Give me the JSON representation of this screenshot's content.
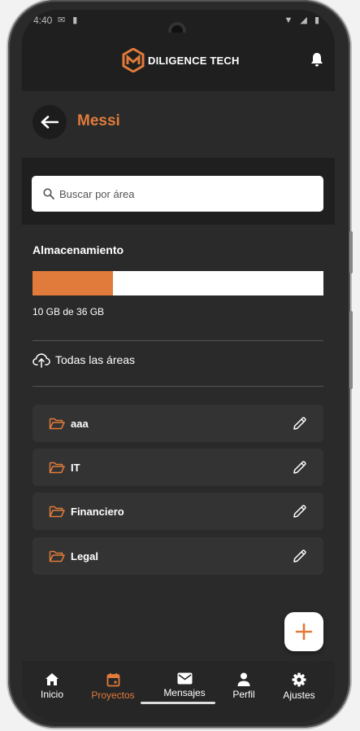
{
  "status_bar": {
    "time": "4:40",
    "left_icons": "✉ ▮",
    "right_icons": "▼ ◢ ▮"
  },
  "header": {
    "logo_text": "DILIGENCE TECH"
  },
  "title_bar": {
    "title": "Messi"
  },
  "search": {
    "placeholder": "Buscar por área",
    "value": ""
  },
  "storage": {
    "title": "Almacenamiento",
    "used_gb": 10,
    "total_gb": 36,
    "used_fraction": 0.2778,
    "label": "10 GB de 36 GB"
  },
  "all_areas": {
    "label": "Todas las áreas"
  },
  "areas": [
    {
      "name": "aaa"
    },
    {
      "name": "IT"
    },
    {
      "name": "Financiero"
    },
    {
      "name": "Legal"
    }
  ],
  "fab": {
    "label": "+"
  },
  "nav": [
    {
      "label": "Inicio",
      "icon": "home-icon",
      "active": false
    },
    {
      "label": "Proyectos",
      "icon": "calendar-icon",
      "active": true
    },
    {
      "label": "Mensajes",
      "icon": "mail-icon",
      "active": false
    },
    {
      "label": "Perfil",
      "icon": "person-icon",
      "active": false
    },
    {
      "label": "Ajustes",
      "icon": "gear-icon",
      "active": false
    }
  ],
  "colors": {
    "accent": "#e07b3b",
    "background": "#2a2a2a",
    "row": "#333333"
  }
}
